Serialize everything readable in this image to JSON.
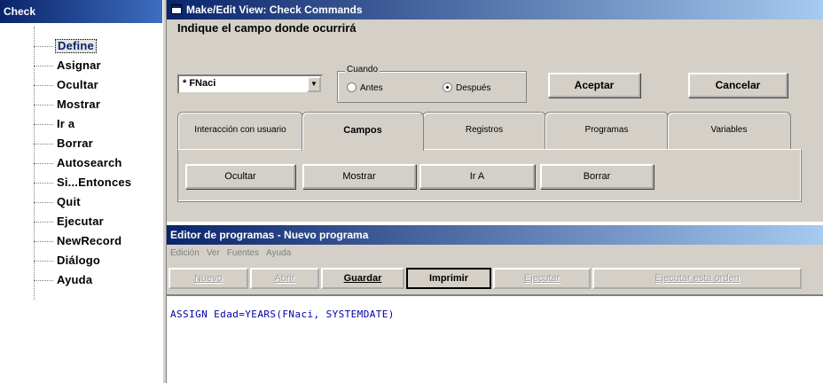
{
  "tree_panel": {
    "title": "Check",
    "items": [
      {
        "label": "Define",
        "selected": true
      },
      {
        "label": "Asignar"
      },
      {
        "label": "Ocultar"
      },
      {
        "label": "Mostrar"
      },
      {
        "label": "Ir a"
      },
      {
        "label": "Borrar"
      },
      {
        "label": "Autosearch"
      },
      {
        "label": "Si...Entonces"
      },
      {
        "label": "Quit"
      },
      {
        "label": "Ejecutar"
      },
      {
        "label": "NewRecord"
      },
      {
        "label": "Diálogo"
      },
      {
        "label": "Ayuda"
      }
    ]
  },
  "make_edit_view": {
    "title": "Make/Edit View: Check Commands",
    "prompt": "Indique el campo donde ocurrirá",
    "field_combo": {
      "value": "* FNaci"
    },
    "cuando": {
      "legend": "Cuando",
      "options": [
        {
          "label": "Antes",
          "checked": false
        },
        {
          "label": "Después",
          "checked": true
        }
      ]
    },
    "accept_label": "Aceptar",
    "cancel_label": "Cancelar",
    "tabs": [
      {
        "label": "Interacción con usuario"
      },
      {
        "label": "Campos",
        "active": true
      },
      {
        "label": "Registros"
      },
      {
        "label": "Programas"
      },
      {
        "label": "Variables"
      }
    ],
    "tab_buttons": [
      {
        "label": "Ocultar"
      },
      {
        "label": "Mostrar"
      },
      {
        "label": "Ir A"
      },
      {
        "label": "Borrar"
      }
    ]
  },
  "editor": {
    "title": "Editor de programas - Nuevo programa",
    "menu": [
      "Edición",
      "Ver",
      "Fuentes",
      "Ayuda"
    ],
    "toolbar": [
      {
        "label": "Nuevo",
        "state": "disabled"
      },
      {
        "label": "Abrir",
        "state": "disabled"
      },
      {
        "label": "Guardar",
        "state": "enabled"
      },
      {
        "label": "Imprimir",
        "state": "pressed"
      },
      {
        "label": "Ejecutar",
        "state": "disabled"
      },
      {
        "label": "Ejecutar esta orden",
        "state": "disabled"
      }
    ],
    "code": "ASSIGN Edad=YEARS(FNaci, SYSTEMDATE)"
  },
  "colors": {
    "titlebar_active": "#0a246a",
    "titlebar_gradient_end": "#a6caf0",
    "face": "#d4d0c8",
    "code_text": "#0000a0"
  }
}
